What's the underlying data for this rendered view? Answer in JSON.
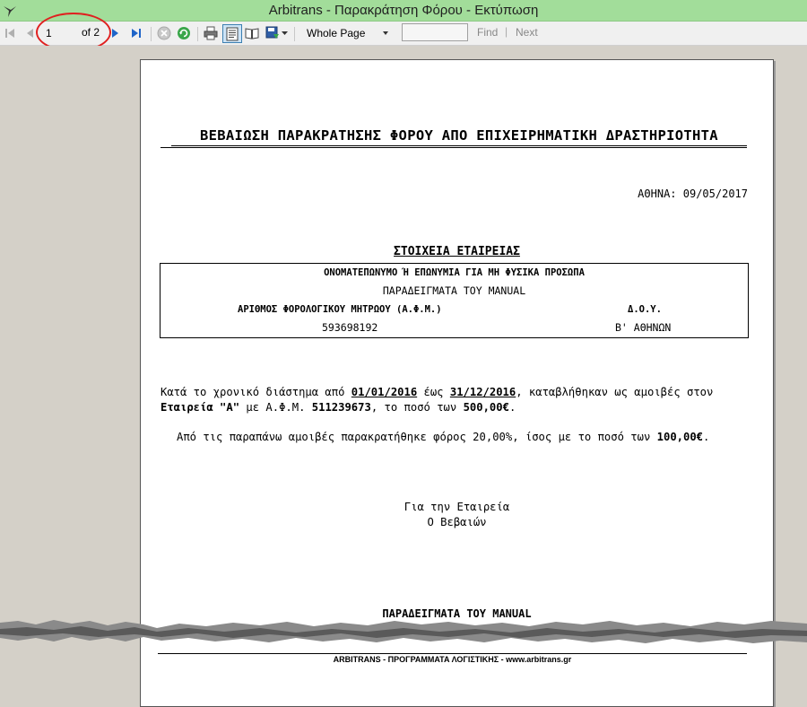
{
  "window": {
    "title": "Arbitrans - Παρακράτηση Φόρου - Εκτύπωση"
  },
  "toolbar": {
    "current_page": "1",
    "of_label": "of",
    "total_pages": "2",
    "view_mode": "Whole Page",
    "find_label": "Find",
    "separator": "|",
    "next_label": "Next",
    "find_value": ""
  },
  "document": {
    "title": "ΒΕΒΑΙΩΣΗ ΠΑΡΑΚΡΑΤΗΣΗΣ ΦΟΡΟΥ ΑΠΟ ΕΠΙΧΕΙΡΗΜΑΤΙΚΗ ΔΡΑΣΤΗΡΙΟΤΗΤΑ",
    "date_line": "ΑΘΗΝΑ: 09/05/2017",
    "section_title": "ΣΤΟΙΧΕΙΑ ΕΤΑΙΡΕΙΑΣ",
    "name_label": "ΟΝΟΜΑΤΕΠΩΝΥΜΟ Ή ΕΠΩΝΥΜΙΑ ΓΙΑ ΜΗ ΦΥΣΙΚΑ ΠΡΟΣΩΠΑ",
    "name_value": "ΠΑΡΑΔΕΙΓΜΑΤΑ ΤΟΥ MANUAL",
    "afm_label": "ΑΡΙΘΜΟΣ ΦΟΡΟΛΟΓΙΚΟΥ ΜΗΤΡΩΟΥ (Α.Φ.Μ.)",
    "afm_value": "593698192",
    "doy_label": "Δ.Ο.Υ.",
    "doy_value": "Β' ΑΘΗΝΩΝ",
    "para1": {
      "t1": "Κατά το χρονικό διάστημα από ",
      "date_from": "01/01/2016",
      "t2": " έως ",
      "date_to": "31/12/2016",
      "t3": ", καταβλήθηκαν ως αμοιβές στον",
      "recipient": "Εταιρεία \"Α\"",
      "t4": " με Α.Φ.Μ. ",
      "recipient_afm": "511239673",
      "t5": ", το ποσό των  ",
      "amount": "500,00€",
      "t6": "."
    },
    "para2": {
      "t1": "Από τις παραπάνω αμοιβές παρακρατήθηκε φόρος 20,00%, ίσος με το ποσό των ",
      "tax_amount": "100,00€",
      "t2": "."
    },
    "sign_line1": "Για την Εταιρεία",
    "sign_line2": "Ο Βεβαιών",
    "company_bottom": "ΠΑΡΑΔΕΙΓΜΑΤΑ ΤΟΥ MANUAL",
    "footer": "ARBITRANS - ΠΡΟΓΡΑΜΜΑΤΑ ΛΟΓΙΣΤΙΚΗΣ - www.arbitrans.gr"
  },
  "colors": {
    "titlebar": "#a2dd9a",
    "highlight": "#e02020",
    "nav_arrow": "#1e64c8"
  }
}
